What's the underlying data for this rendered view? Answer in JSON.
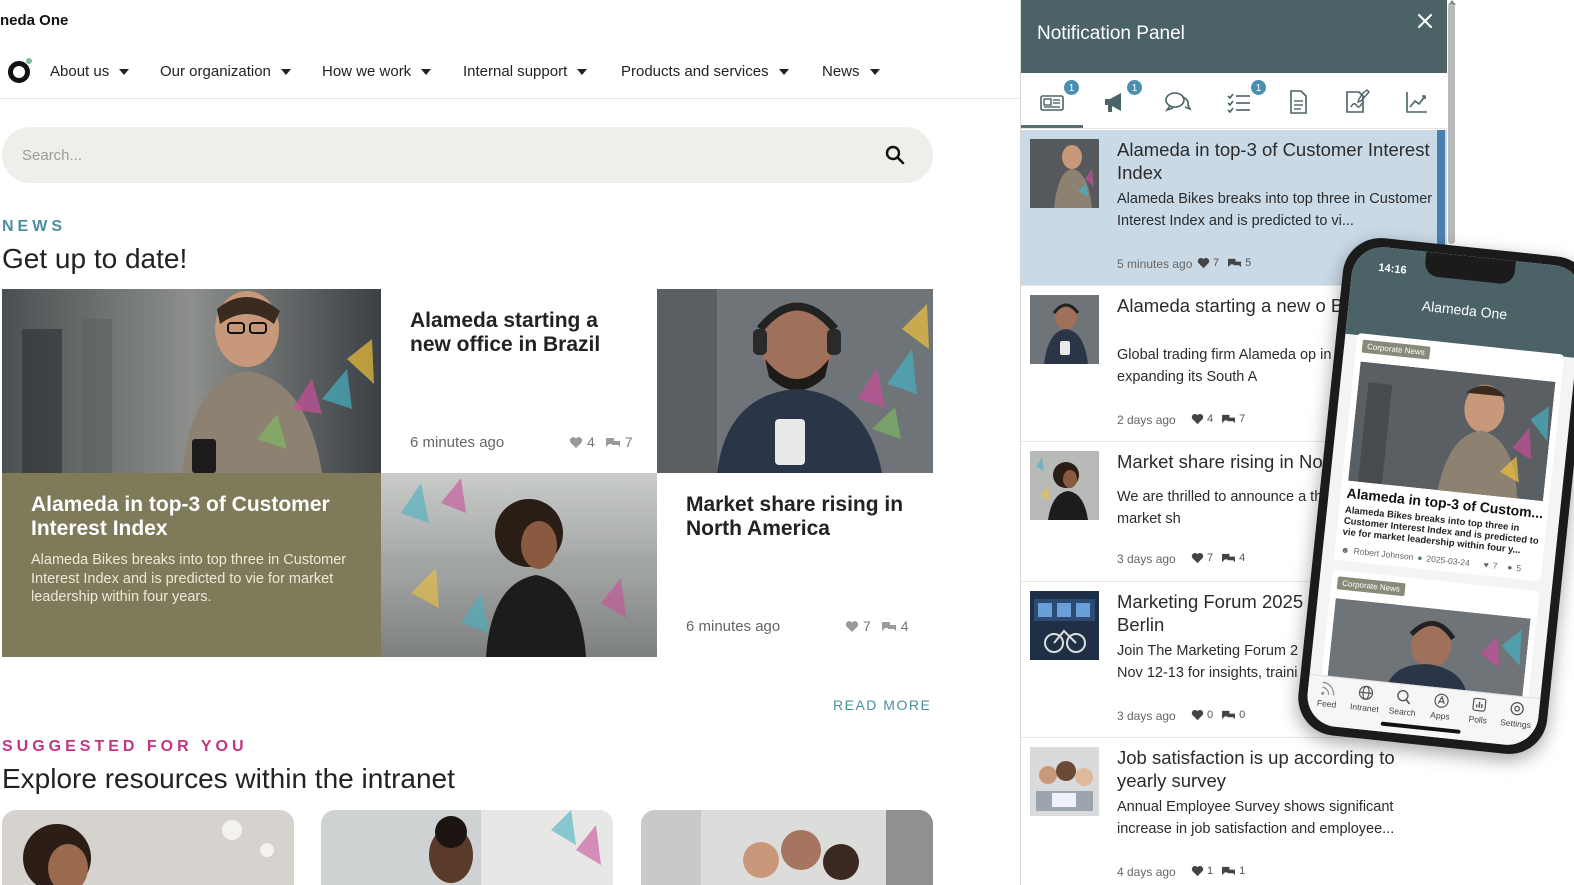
{
  "app": {
    "brand": "neda One"
  },
  "nav": {
    "items": [
      {
        "label": "About us"
      },
      {
        "label": "Our organization"
      },
      {
        "label": "How we work"
      },
      {
        "label": "Internal support"
      },
      {
        "label": "Products and services"
      },
      {
        "label": "News"
      }
    ]
  },
  "search": {
    "placeholder": "Search..."
  },
  "news": {
    "eyebrow": "NEWS",
    "title": "Get up to date!",
    "tiles": [
      {
        "title": "Alameda starting a new office in Brazil",
        "time": "6 minutes ago",
        "likes": "4",
        "comments": "7"
      },
      {
        "title": "Alameda in top-3 of Customer Interest Index",
        "desc": "Alameda Bikes breaks into top three in Customer Interest Index and is predicted to vie for market leadership within four years."
      },
      {
        "title": "Market share rising in North America",
        "time": "6 minutes ago",
        "likes": "7",
        "comments": "4"
      }
    ],
    "read_more": "READ MORE"
  },
  "suggested": {
    "eyebrow": "SUGGESTED FOR YOU",
    "title": "Explore resources within the intranet"
  },
  "panel": {
    "title": "Notification Panel",
    "tabs": [
      {
        "icon": "newspaper-icon",
        "badge": "1"
      },
      {
        "icon": "megaphone-icon",
        "badge": "1"
      },
      {
        "icon": "chat-icon",
        "badge": ""
      },
      {
        "icon": "checklist-icon",
        "badge": "1"
      },
      {
        "icon": "document-icon",
        "badge": ""
      },
      {
        "icon": "signature-icon",
        "badge": ""
      },
      {
        "icon": "chart-icon",
        "badge": ""
      }
    ],
    "items": [
      {
        "title": "Alameda in top-3 of Customer Interest Index",
        "desc": "Alameda Bikes breaks into top three in Customer Interest Index and is predicted to vi...",
        "time": "5 minutes ago",
        "likes": "7",
        "comments": "5"
      },
      {
        "title": "Alameda starting a new o Brazil",
        "desc": "Global trading firm Alameda op in Brazil, expanding its South A",
        "time": "2 days ago",
        "likes": "4",
        "comments": "7"
      },
      {
        "title": "Market share rising in No",
        "desc": "We are thrilled to announce a the North America market sh",
        "time": "3 days ago",
        "likes": "7",
        "comments": "4"
      },
      {
        "title": "Marketing Forum 2025 Berlin",
        "desc": "Join The Marketing Forum 2 Nov 12-13 for insights, traini",
        "time": "3 days ago",
        "likes": "0",
        "comments": "0"
      },
      {
        "title": "Job satisfaction is up according to yearly survey",
        "desc": "Annual Employee Survey shows significant increase in job satisfaction and employee...",
        "time": "4 days ago",
        "likes": "1",
        "comments": "1"
      }
    ]
  },
  "phone": {
    "time": "14:16",
    "title": "Alameda One",
    "cards": [
      {
        "tag": "Corporate News",
        "title": "Alameda in top-3 of Custom...",
        "desc": "Alameda Bikes breaks into top three in Customer Interest Index and is predicted to vie for market leadership within four y...",
        "author": "Robert Johnson",
        "date": "2025-03-24",
        "likes": "7",
        "comments": "5"
      },
      {
        "tag": "Corporate News"
      }
    ],
    "tabbar": [
      {
        "label": "Feed",
        "icon": "rss-icon"
      },
      {
        "label": "Intranet",
        "icon": "globe-icon"
      },
      {
        "label": "Search",
        "icon": "search-icon"
      },
      {
        "label": "Apps",
        "icon": "apps-icon"
      },
      {
        "label": "Polls",
        "icon": "bar-chart-icon"
      },
      {
        "label": "Settings",
        "icon": "settings-icon"
      }
    ]
  },
  "colors": {
    "panel_header": "#4b6266",
    "news_accent": "#4a8fa0",
    "suggested_accent": "#c2357f",
    "olive_tile": "#7e7a5a",
    "active_item": "#c9d9e6"
  }
}
